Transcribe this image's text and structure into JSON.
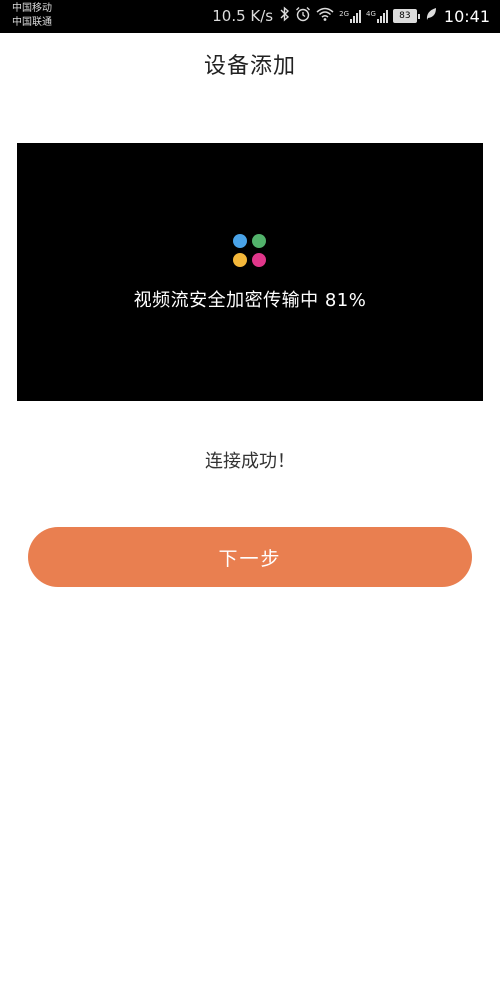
{
  "status_bar": {
    "carrier_1": "中国移动",
    "carrier_2": "中国联通",
    "net_speed": "10.5 K/s",
    "net_tag_1": "2G",
    "net_tag_2": "4G",
    "battery": "83",
    "time": "10:41",
    "icons": [
      "bluetooth-icon",
      "alarm-icon",
      "wifi-icon",
      "signal-2g-icon",
      "signal-4g-icon",
      "battery-icon",
      "leaf-icon"
    ]
  },
  "header": {
    "title": "设备添加"
  },
  "video": {
    "progress_text": "视频流安全加密传输中 81%",
    "progress_percent": 81,
    "dot_colors": {
      "blue": "#4aa3e8",
      "green": "#52b26b",
      "yellow": "#f4b73a",
      "pink": "#e0368a"
    }
  },
  "main": {
    "success_text": "连接成功！"
  },
  "actions": {
    "next_label": "下一步"
  },
  "theme": {
    "accent": "#e97f50"
  }
}
